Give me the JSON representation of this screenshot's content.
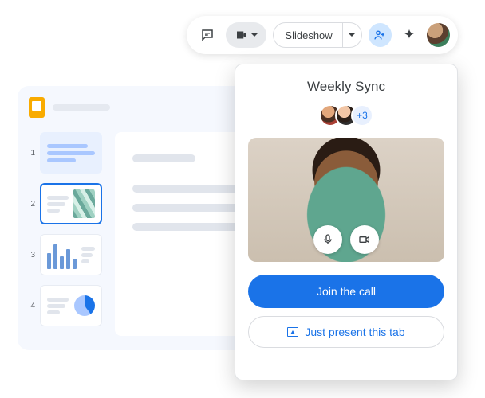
{
  "toolbar": {
    "slideshow_label": "Slideshow"
  },
  "slides": {
    "thumbs": [
      "1",
      "2",
      "3",
      "4"
    ]
  },
  "meet": {
    "title": "Weekly Sync",
    "extra_count": "+3",
    "join_label": "Join the call",
    "present_label": "Just present this tab"
  }
}
